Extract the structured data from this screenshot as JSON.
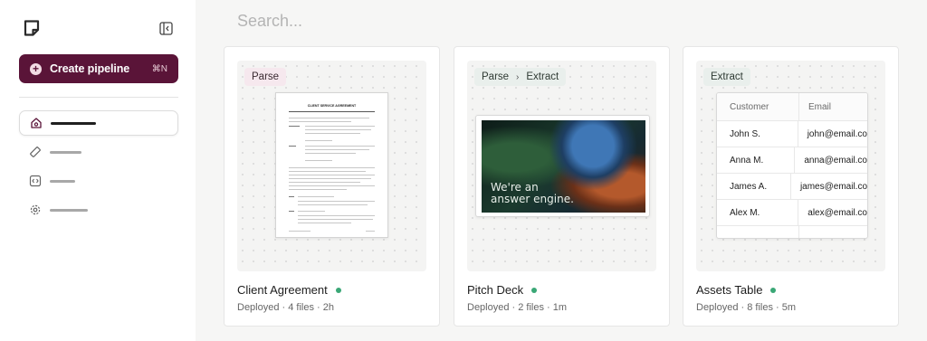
{
  "sidebar": {
    "create_label": "Create pipeline",
    "create_shortcut": "⌘N",
    "nav_icons": [
      "home-icon",
      "ruler-icon",
      "code-icon",
      "gear-icon"
    ]
  },
  "search": {
    "placeholder": "Search..."
  },
  "cards": [
    {
      "tags": [
        "Parse"
      ],
      "title": "Client Agreement",
      "meta": "Deployed · 4 files · 2h",
      "status_color": "#3aa776",
      "doc_title": "CLIENT SERVICE AGREEMENT"
    },
    {
      "tags": [
        "Parse",
        "Extract"
      ],
      "title": "Pitch Deck",
      "meta": "Deployed · 2 files · 1m",
      "status_color": "#3aa776",
      "slide_text": [
        "We're an",
        "answer engine."
      ]
    },
    {
      "tags": [
        "Extract"
      ],
      "title": "Assets Table",
      "meta": "Deployed · 8 files · 5m",
      "status_color": "#3aa776",
      "table": {
        "headers": [
          "Customer",
          "Email"
        ],
        "rows": [
          [
            "John S.",
            "john@email.co"
          ],
          [
            "Anna M.",
            "anna@email.co"
          ],
          [
            "James A.",
            "james@email.co"
          ],
          [
            "Alex M.",
            "alex@email.co"
          ]
        ]
      }
    }
  ],
  "colors": {
    "accent": "#5a1438",
    "status": "#3aa776"
  }
}
